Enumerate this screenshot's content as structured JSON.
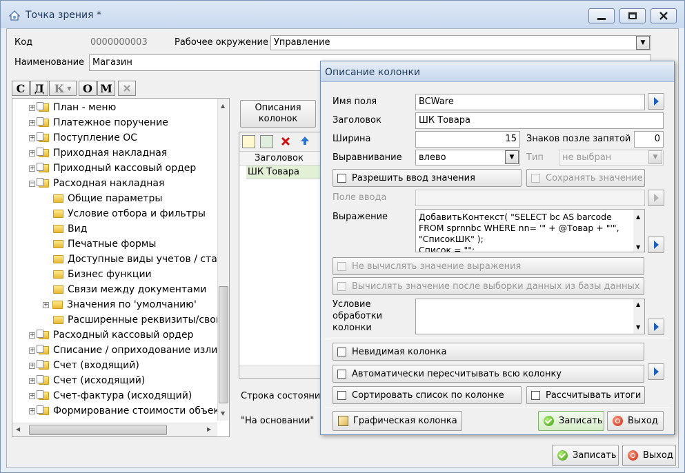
{
  "window": {
    "title": "Точка зрения *",
    "code_label": "Код",
    "code_value": "0000000003",
    "env_label": "Рабочее окружение",
    "env_value": "Управление",
    "name_label": "Наименование",
    "name_value": "Магазин",
    "toolbar_letters": [
      "С",
      "Д",
      "К",
      "О",
      "М"
    ],
    "tree_items": [
      {
        "label": "План - меню",
        "level": 1,
        "exp": "+"
      },
      {
        "label": "Платежное поручение",
        "level": 1,
        "exp": "+"
      },
      {
        "label": "Поступление ОС",
        "level": 1,
        "exp": "+"
      },
      {
        "label": "Приходная накладная",
        "level": 1,
        "exp": "+"
      },
      {
        "label": "Приходный кассовый ордер",
        "level": 1,
        "exp": "+"
      },
      {
        "label": "Расходная накладная",
        "level": 1,
        "exp": "−"
      },
      {
        "label": "Общие параметры",
        "level": 2,
        "exp": ""
      },
      {
        "label": "Условие отбора и фильтры",
        "level": 2,
        "exp": ""
      },
      {
        "label": "Вид",
        "level": 2,
        "exp": ""
      },
      {
        "label": "Печатные формы",
        "level": 2,
        "exp": ""
      },
      {
        "label": "Доступные виды учетов / статуты",
        "level": 2,
        "exp": ""
      },
      {
        "label": "Бизнес функции",
        "level": 2,
        "exp": ""
      },
      {
        "label": "Связи между документами",
        "level": 2,
        "exp": ""
      },
      {
        "label": "Значения по 'умолчанию'",
        "level": 2,
        "exp": "+"
      },
      {
        "label": "Расширенные реквизиты/свойства",
        "level": 2,
        "exp": ""
      },
      {
        "label": "Расходный кассовый ордер",
        "level": 1,
        "exp": "+"
      },
      {
        "label": "Списание / оприходование излишков",
        "level": 1,
        "exp": "+"
      },
      {
        "label": "Счет (входящий)",
        "level": 1,
        "exp": "+"
      },
      {
        "label": "Счет (исходящий)",
        "level": 1,
        "exp": "+"
      },
      {
        "label": "Счет-фактура (исходящий)",
        "level": 1,
        "exp": "+"
      },
      {
        "label": "Формирование стоимости объектов",
        "level": 1,
        "exp": "+"
      }
    ],
    "col_desc_button": "Описания колонок",
    "grid_header": "Заголовок",
    "grid_row": "ШК Товара",
    "status_label": "Строка состояния",
    "basis_label": "\"На основании\"",
    "save": "Записать",
    "exit": "Выход"
  },
  "dialog": {
    "title": "Описание колонки",
    "field_name_label": "Имя поля",
    "field_name_value": "BCWare",
    "header_label": "Заголовок",
    "header_value": "ШК Товара",
    "width_label": "Ширина",
    "width_value": "15",
    "decimals_label": "Знаков позле запятой",
    "decimals_value": "0",
    "align_label": "Выравнивание",
    "align_value": "влево",
    "type_label": "Тип",
    "type_value": "не выбран",
    "allow_input": "Разрешить ввод значения",
    "save_value": "Сохранять значение",
    "input_field_label": "Поле ввода",
    "expr_label": "Выражение",
    "expr_line1": "ДобавитьКонтекст( \"SELECT bc AS barcode",
    "expr_line2": "FROM sprnnbc WHERE nn= '\" + @Товар + \"'\",",
    "expr_line3": "\"СписокШК\" );",
    "expr_line4": "Список = \"\";",
    "no_calc": "Не вычислять значение выражения",
    "calc_after": "Вычислять значение после выборки данных из базы данных",
    "cond_label_1": "Условие",
    "cond_label_2": "обработки",
    "cond_label_3": "колонки",
    "invisible": "Невидимая колонка",
    "auto_recalc": "Автоматически пересчитывать всю колонку",
    "sort_by": "Сортировать список по колонке",
    "totals": "Рассчитывать итоги",
    "graphic_col": "Графическая колонка",
    "save": "Записать",
    "exit": "Выход"
  }
}
